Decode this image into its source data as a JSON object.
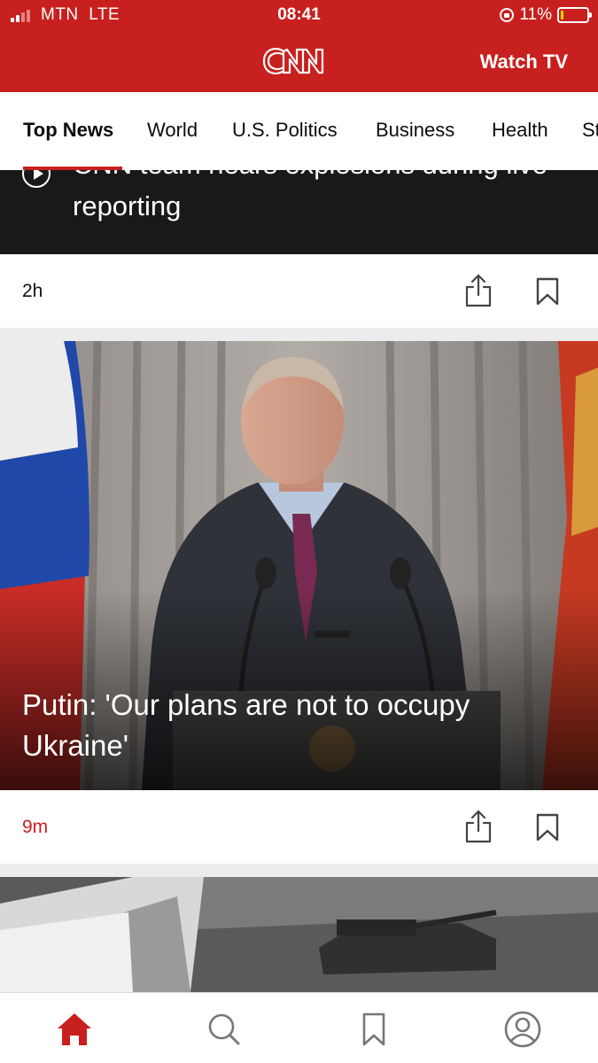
{
  "status_bar": {
    "carrier": "MTN  LTE",
    "time": "08:41",
    "battery": "11%",
    "battery_level": 0.11,
    "icons": [
      "signal-icon",
      "orientation-lock-icon",
      "battery-icon"
    ]
  },
  "header": {
    "logo": "CNN",
    "watch_tv": "Watch TV",
    "brand_color": "#c8201e"
  },
  "tabs": [
    {
      "label": "Top News",
      "active": true
    },
    {
      "label": "World",
      "active": false
    },
    {
      "label": "U.S. Politics",
      "active": false
    },
    {
      "label": "Business",
      "active": false
    },
    {
      "label": "Health",
      "active": false
    },
    {
      "label": "St",
      "active": false
    }
  ],
  "video_story": {
    "title": "CNN team hears explosions during live reporting",
    "icon": "play-icon",
    "time": "2h"
  },
  "hero_story": {
    "title": "Putin: 'Our plans are not to occupy Ukraine'",
    "time": "9m",
    "time_color": "#c8201e"
  },
  "actions": {
    "share_icon": "share-icon",
    "bookmark_icon": "bookmark-icon"
  },
  "bottom_nav": [
    {
      "icon": "home-icon",
      "active": true
    },
    {
      "icon": "search-icon",
      "active": false
    },
    {
      "icon": "bookmark-icon",
      "active": false
    },
    {
      "icon": "profile-icon",
      "active": false
    }
  ]
}
